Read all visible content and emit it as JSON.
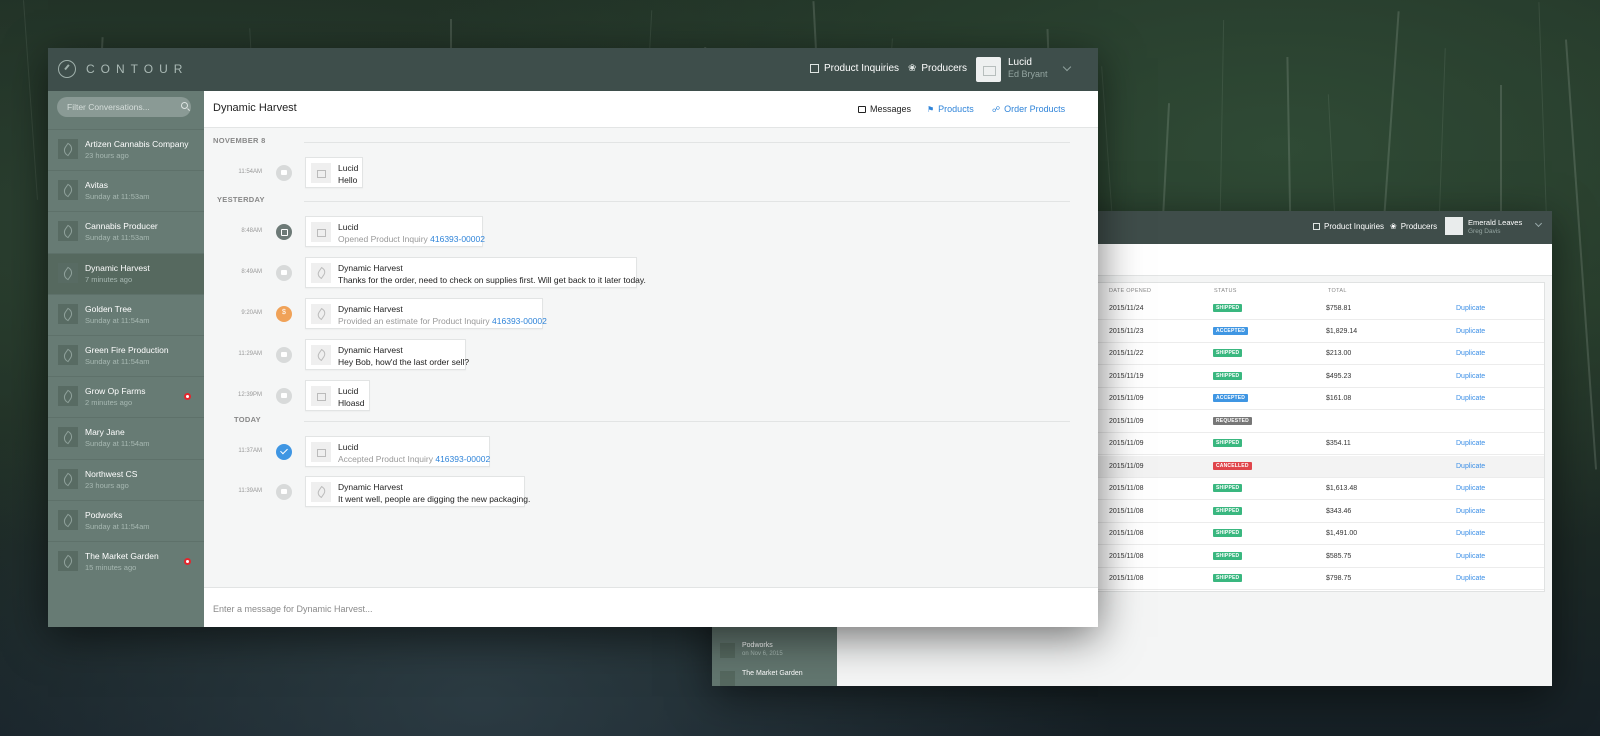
{
  "app": {
    "logo": "CONTOUR"
  },
  "header": {
    "nav": [
      {
        "label": "Product Inquiries",
        "icon": "list-icon"
      },
      {
        "label": "Producers",
        "icon": "leaf-icon"
      }
    ],
    "user": {
      "name": "Lucid",
      "sub": "Ed Bryant"
    }
  },
  "sidebar": {
    "filter_placeholder": "Filter Conversations...",
    "items": [
      {
        "name": "Artizen Cannabis Company",
        "time": "23 hours ago",
        "unread": false
      },
      {
        "name": "Avitas",
        "time": "Sunday at 11:53am",
        "unread": false
      },
      {
        "name": "Cannabis Producer",
        "time": "Sunday at 11:53am",
        "unread": false
      },
      {
        "name": "Dynamic Harvest",
        "time": "7 minutes ago",
        "unread": false,
        "active": true
      },
      {
        "name": "Golden Tree",
        "time": "Sunday at 11:54am",
        "unread": false
      },
      {
        "name": "Green Fire Production",
        "time": "Sunday at 11:54am",
        "unread": false
      },
      {
        "name": "Grow Op Farms",
        "time": "2 minutes ago",
        "unread": true
      },
      {
        "name": "Mary Jane",
        "time": "Sunday at 11:54am",
        "unread": false
      },
      {
        "name": "Northwest CS",
        "time": "23 hours ago",
        "unread": false
      },
      {
        "name": "Podworks",
        "time": "Sunday at 11:54am",
        "unread": false
      },
      {
        "name": "The Market Garden",
        "time": "15 minutes ago",
        "unread": true
      }
    ]
  },
  "conversation": {
    "title": "Dynamic Harvest",
    "tabs": [
      {
        "label": "Messages",
        "color": "#222222"
      },
      {
        "label": "Products",
        "color": "#2f84d9"
      },
      {
        "label": "Order Products",
        "color": "#2f84d9"
      }
    ],
    "dates": [
      "NOVEMBER 8",
      "YESTERDAY",
      "TODAY"
    ],
    "messages": [
      {
        "time": "11:54AM",
        "sender": "Lucid",
        "text": "Hello",
        "kind": "message"
      },
      {
        "time": "8:48AM",
        "sender": "Lucid",
        "text": "Opened Product Inquiry ",
        "link": "416393-00002",
        "kind": "opened"
      },
      {
        "time": "8:49AM",
        "sender": "Dynamic Harvest",
        "text": "Thanks for the order, need to check on supplies first. Will get back to it later today.",
        "kind": "message"
      },
      {
        "time": "9:20AM",
        "sender": "Dynamic Harvest",
        "text": "Provided an estimate for Product Inquiry ",
        "link": "416393-00002",
        "kind": "estimate"
      },
      {
        "time": "11:29AM",
        "sender": "Dynamic Harvest",
        "text": "Hey Bob, how'd the last order sell?",
        "kind": "message"
      },
      {
        "time": "12:39PM",
        "sender": "Lucid",
        "text": "Hloasd",
        "kind": "message"
      },
      {
        "time": "11:37AM",
        "sender": "Lucid",
        "text": "Accepted Product Inquiry ",
        "link": "416393-00002",
        "kind": "accepted"
      },
      {
        "time": "11:39AM",
        "sender": "Dynamic Harvest",
        "text": "It went well, people are digging the new packaging.",
        "kind": "message"
      }
    ],
    "input_placeholder": "Enter a message for Dynamic Harvest..."
  },
  "back_window": {
    "nav": [
      "Product Inquiries",
      "Producers"
    ],
    "user": {
      "name": "Emerald Leaves",
      "sub": "Greg Davis"
    },
    "columns": [
      "DATE OPENED",
      "STATUS",
      "TOTAL"
    ],
    "rows": [
      {
        "date": "2015/11/24",
        "status": "SHIPPED",
        "total": "$758.81",
        "action": "Duplicate"
      },
      {
        "date": "2015/11/23",
        "status": "ACCEPTED",
        "total": "$1,829.14",
        "action": "Duplicate"
      },
      {
        "date": "2015/11/22",
        "status": "SHIPPED",
        "total": "$213.00",
        "action": "Duplicate"
      },
      {
        "date": "2015/11/19",
        "status": "SHIPPED",
        "total": "$495.23",
        "action": "Duplicate"
      },
      {
        "date": "2015/11/09",
        "status": "ACCEPTED",
        "total": "$161.08",
        "action": "Duplicate"
      },
      {
        "date": "2015/11/09",
        "status": "REQUESTED",
        "total": "",
        "action": ""
      },
      {
        "date": "2015/11/09",
        "status": "SHIPPED",
        "total": "$354.11",
        "action": "Duplicate"
      },
      {
        "date": "2015/11/09",
        "status": "CANCELLED",
        "total": "",
        "action": "Duplicate"
      },
      {
        "date": "2015/11/08",
        "status": "SHIPPED",
        "total": "$1,613.48",
        "action": "Duplicate"
      },
      {
        "date": "2015/11/08",
        "status": "SHIPPED",
        "total": "$343.46",
        "action": "Duplicate"
      },
      {
        "date": "2015/11/08",
        "status": "SHIPPED",
        "total": "$1,491.00",
        "action": "Duplicate"
      },
      {
        "date": "2015/11/08",
        "status": "SHIPPED",
        "total": "$585.75",
        "action": "Duplicate"
      },
      {
        "date": "2015/11/08",
        "status": "SHIPPED",
        "total": "$798.75",
        "action": "Duplicate"
      }
    ],
    "status_colors": {
      "SHIPPED": "#39b77f",
      "ACCEPTED": "#3f96e3",
      "REQUESTED": "#777777",
      "CANCELLED": "#e0454b"
    },
    "sidebar": [
      {
        "name": "Podworks",
        "time": "on Nov 6, 2015"
      },
      {
        "name": "The Market Garden",
        "time": ""
      }
    ]
  }
}
